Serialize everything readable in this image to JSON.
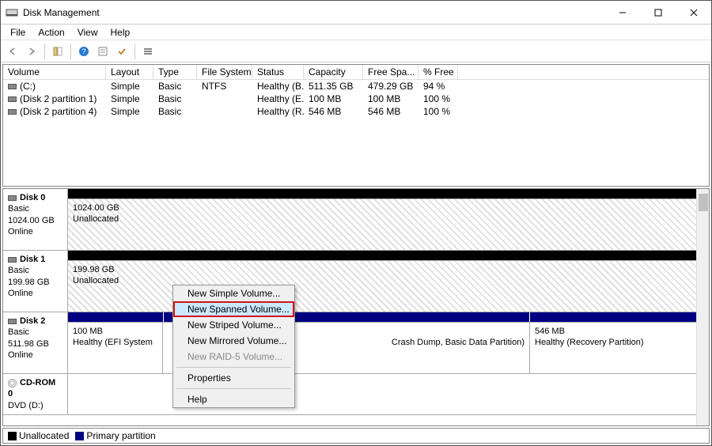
{
  "window": {
    "title": "Disk Management"
  },
  "menu": {
    "file": "File",
    "action": "Action",
    "view": "View",
    "help": "Help"
  },
  "volHeaders": {
    "volume": "Volume",
    "layout": "Layout",
    "type": "Type",
    "fs": "File System",
    "status": "Status",
    "capacity": "Capacity",
    "free": "Free Spa...",
    "pct": "% Free"
  },
  "volumes": [
    {
      "name": "(C:)",
      "layout": "Simple",
      "type": "Basic",
      "fs": "NTFS",
      "status": "Healthy (B...",
      "capacity": "511.35 GB",
      "free": "479.29 GB",
      "pct": "94 %"
    },
    {
      "name": "(Disk 2 partition 1)",
      "layout": "Simple",
      "type": "Basic",
      "fs": "",
      "status": "Healthy (E...",
      "capacity": "100 MB",
      "free": "100 MB",
      "pct": "100 %"
    },
    {
      "name": "(Disk 2 partition 4)",
      "layout": "Simple",
      "type": "Basic",
      "fs": "",
      "status": "Healthy (R...",
      "capacity": "546 MB",
      "free": "546 MB",
      "pct": "100 %"
    }
  ],
  "disks": {
    "d0": {
      "name": "Disk 0",
      "type": "Basic",
      "size": "1024.00 GB",
      "state": "Online",
      "p0": {
        "size": "1024.00 GB",
        "label": "Unallocated"
      }
    },
    "d1": {
      "name": "Disk 1",
      "type": "Basic",
      "size": "199.98 GB",
      "state": "Online",
      "p0": {
        "size": "199.98 GB",
        "label": "Unallocated"
      }
    },
    "d2": {
      "name": "Disk 2",
      "type": "Basic",
      "size": "511.98 GB",
      "state": "Online",
      "p0": {
        "size": "100 MB",
        "label": "Healthy (EFI System"
      },
      "p1": {
        "label": "Crash Dump, Basic Data Partition)"
      },
      "p2": {
        "size": "546 MB",
        "label": "Healthy (Recovery Partition)"
      }
    },
    "cd": {
      "name": "CD-ROM 0",
      "sub": "DVD (D:)"
    }
  },
  "legend": {
    "unalloc": "Unallocated",
    "primary": "Primary partition"
  },
  "ctx": {
    "simple": "New Simple Volume...",
    "spanned": "New Spanned Volume...",
    "striped": "New Striped Volume...",
    "mirrored": "New Mirrored Volume...",
    "raid5": "New RAID-5 Volume...",
    "props": "Properties",
    "help": "Help"
  }
}
